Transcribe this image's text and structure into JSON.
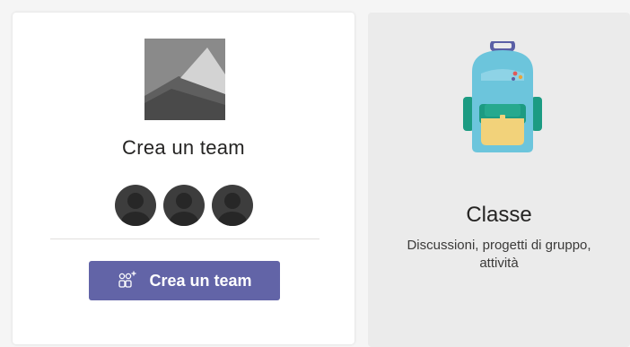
{
  "create_card": {
    "title": "Crea un team",
    "button_label": "Crea un team",
    "button_color": "#6264a7"
  },
  "class_card": {
    "title": "Classe",
    "description_line1": "Discussioni, progetti di gruppo,",
    "description_line2": "attività"
  },
  "colors": {
    "backpack_body": "#6cc5dc",
    "backpack_pocket": "#f2d27a",
    "backpack_strap": "#1c9b82",
    "handle": "#5a5fa6"
  },
  "icons": [
    "image-placeholder-icon",
    "person-avatar-icon",
    "add-team-icon",
    "backpack-icon"
  ]
}
